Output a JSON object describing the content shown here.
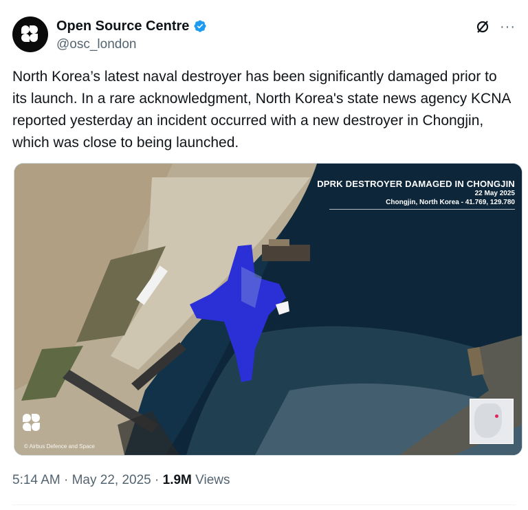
{
  "author": {
    "display_name": "Open Source Centre",
    "handle": "@osc_london",
    "avatar_text": "Open Source Centre"
  },
  "actions": {
    "grok_icon": "grok-slash-circle-icon",
    "more_icon": "more-horizontal-icon",
    "more_label": "···"
  },
  "tweet": {
    "text": "North Korea’s latest naval destroyer has been significantly damaged prior to its launch. In a rare acknowledgment, North Korea's state news agency KCNA reported yesterday an incident occurred with a new destroyer in Chongjin, which was close to being launched."
  },
  "media": {
    "overlay_title": "DPRK DESTROYER DAMAGED IN CHONGJIN",
    "overlay_date": "22 May 2025",
    "overlay_location": "Chongjin, North Korea - 41.769, 129.780",
    "credit": "© Airbus Defence and Space",
    "logo_text": "Open Source Centre"
  },
  "meta": {
    "time": "5:14 AM",
    "separator1": " · ",
    "date": "May 22, 2025",
    "separator2": " · ",
    "views_count": "1.9M",
    "views_label": " Views"
  },
  "colors": {
    "verified_blue": "#1d9bf0",
    "text_secondary": "#536471",
    "water": "#0f2a3c",
    "tarp_blue": "#2b2fd6"
  }
}
